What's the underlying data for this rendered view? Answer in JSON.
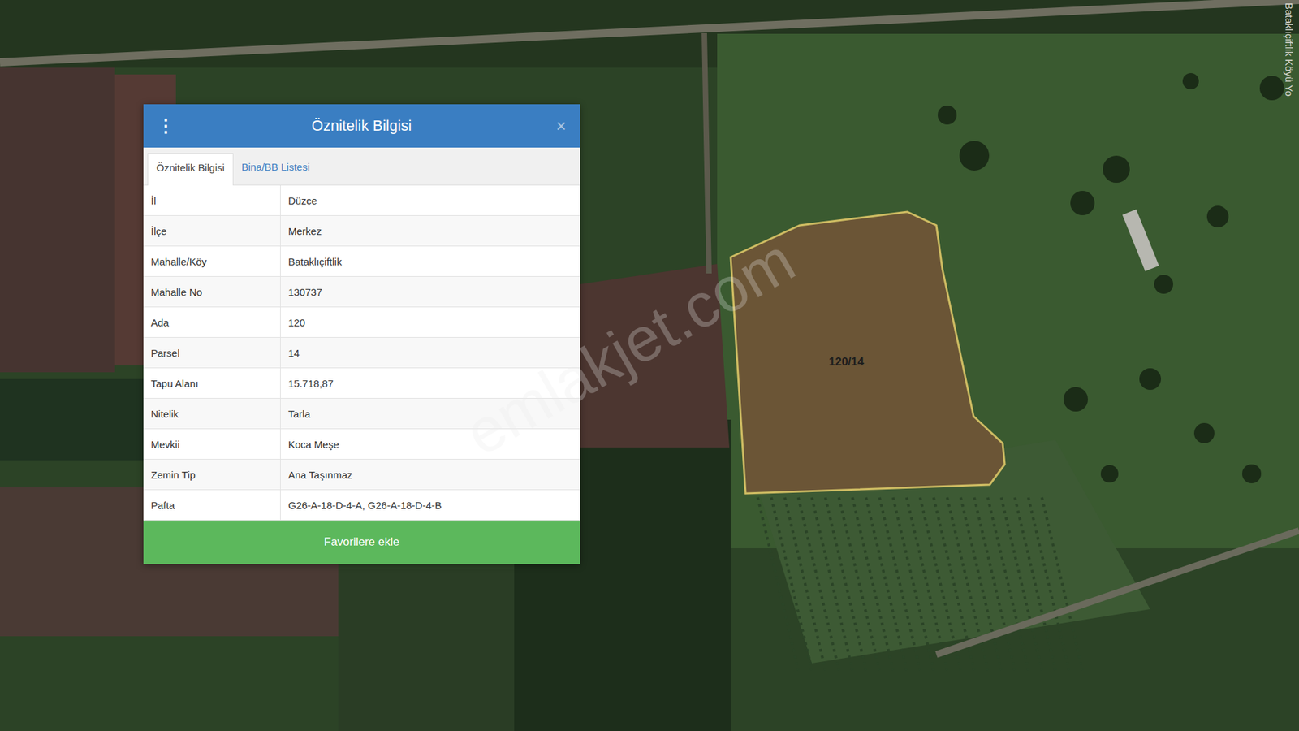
{
  "map": {
    "parcel_label": "120/14",
    "road_label": "Bataklıçiftlik Köyü Yo",
    "watermark": "emlakjet.com"
  },
  "popup": {
    "menu_icon": "⋮",
    "title": "Öznitelik Bilgisi",
    "close": "×",
    "tabs": [
      {
        "label": "Öznitelik Bilgisi",
        "selected": true
      },
      {
        "label": "Bina/BB Listesi",
        "selected": false
      }
    ],
    "rows": [
      {
        "label": "İl",
        "value": "Düzce"
      },
      {
        "label": "İlçe",
        "value": "Merkez"
      },
      {
        "label": "Mahalle/Köy",
        "value": "Bataklıçiftlik"
      },
      {
        "label": "Mahalle No",
        "value": "130737"
      },
      {
        "label": "Ada",
        "value": "120"
      },
      {
        "label": "Parsel",
        "value": "14"
      },
      {
        "label": "Tapu Alanı",
        "value": "15.718,87"
      },
      {
        "label": "Nitelik",
        "value": "Tarla"
      },
      {
        "label": "Mevkii",
        "value": "Koca Meşe"
      },
      {
        "label": "Zemin Tip",
        "value": "Ana Taşınmaz"
      },
      {
        "label": "Pafta",
        "value": "G26-A-18-D-4-A, G26-A-18-D-4-B"
      }
    ],
    "button": "Favorilere ekle"
  }
}
